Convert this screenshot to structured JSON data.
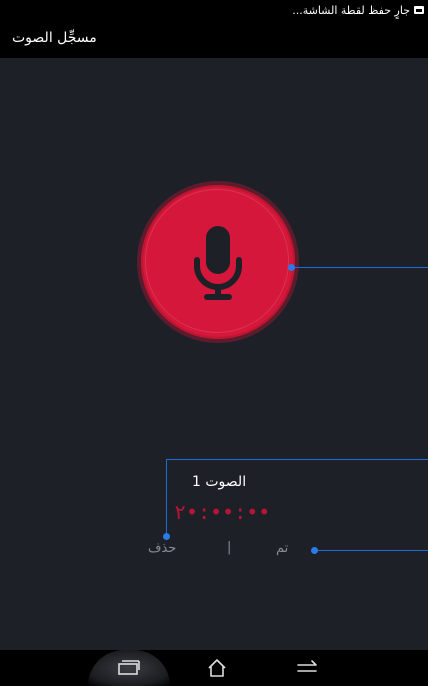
{
  "status_bar": {
    "text": "جارٍ حفظ لقطة الشاشة..."
  },
  "app_bar": {
    "title": "مسجِّل الصوت"
  },
  "record_button": {
    "icon": "microphone-icon",
    "color": "#d4173a"
  },
  "recording": {
    "name": "الصوت 1",
    "timer": "٢•:••:••",
    "timer_color": "#b81434"
  },
  "actions": {
    "delete_label": "حذف",
    "separator": "|",
    "done_label": "تم"
  },
  "callout_color": "#1d6bd6",
  "nav_bar": {
    "items": [
      "recent-apps-icon",
      "home-icon",
      "back-icon"
    ]
  }
}
